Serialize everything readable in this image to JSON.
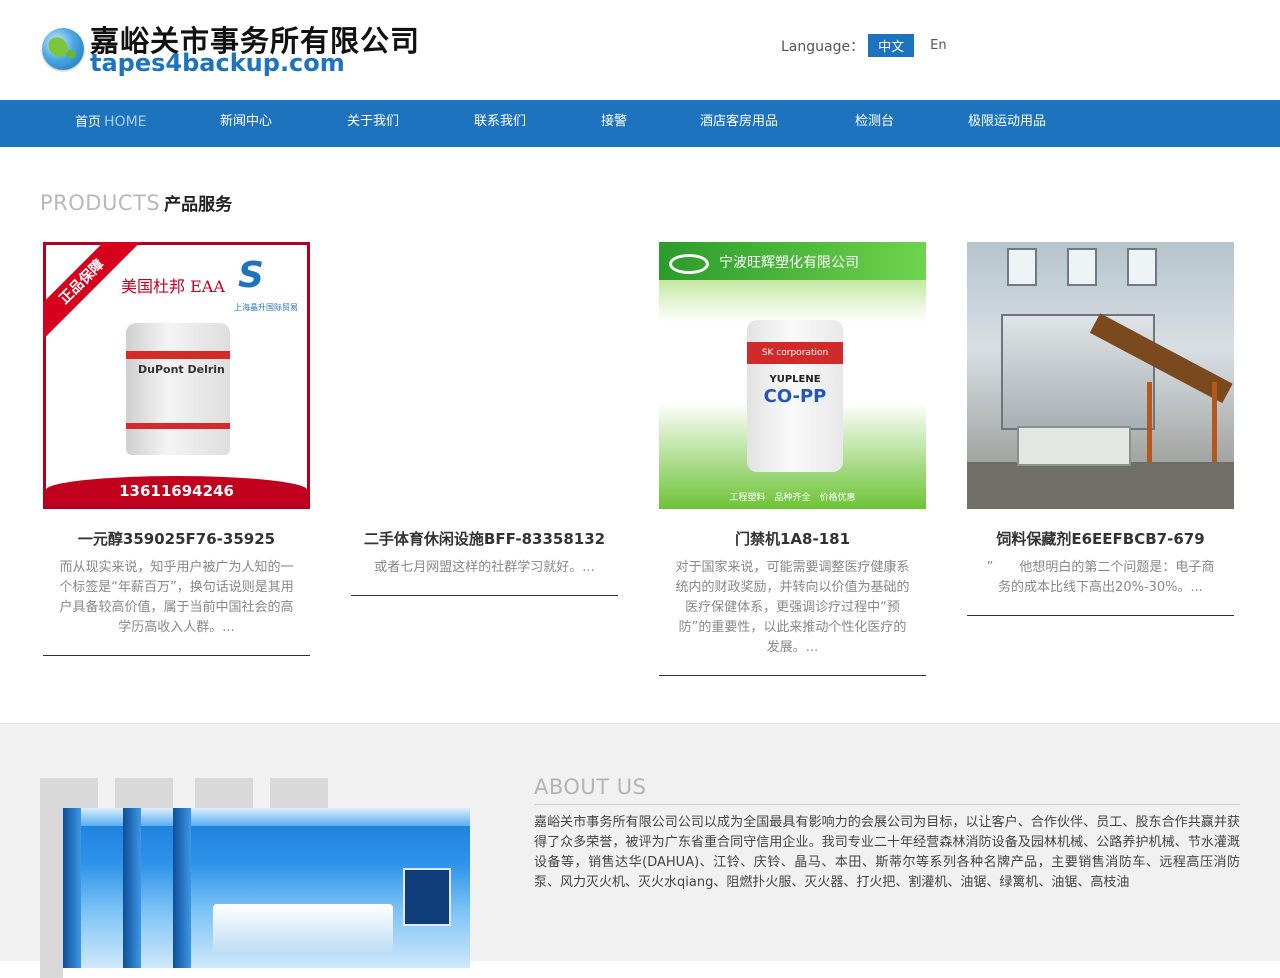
{
  "header": {
    "logo_title": "嘉峪关市事务所有限公司",
    "logo_domain": "tapes4backup.com",
    "language_label": "Language：",
    "lang_options": [
      "中文",
      "En"
    ]
  },
  "nav": {
    "items": [
      {
        "label": "首页",
        "sub": "HOME"
      },
      {
        "label": "新闻中心"
      },
      {
        "label": "关于我们"
      },
      {
        "label": "联系我们"
      },
      {
        "label": "接警"
      },
      {
        "label": "酒店客房用品"
      },
      {
        "label": "检测台"
      },
      {
        "label": "极限运动用品"
      }
    ]
  },
  "products": {
    "title_en": "PRODUCTS",
    "title_cn": "产品服务",
    "items": [
      {
        "name": "一元醇359025F76-35925",
        "desc": "而从现实来说，知乎用户被广为人知的一个标签是“年薪百万”，换句话说则是其用户具备较高价值，属于当前中国社会的高学历高收入人群。...",
        "image": {
          "ribbon": "正品保障",
          "caption": "美国杜邦 EAA",
          "brand": "S",
          "brand_sub": "上海晶升国际贸易",
          "bag_text": "DuPont Delrin",
          "phone": "13611694246"
        }
      },
      {
        "name": "二手体育休闲设施BFF-83358132",
        "desc": "或者七月网盟这样的社群学习就好。...",
        "image": null
      },
      {
        "name": "门禁机1A8-181",
        "desc": "对于国家来说，可能需要调整医疗健康系统内的财政奖励，并转向以价值为基础的医疗保健体系，更强调诊疗过程中“预防”的重要性，以此来推动个性化医疗的发展。...",
        "image": {
          "company": "宁波旺辉塑化有限公司",
          "bag_band": "SK corporation",
          "bag_t1": "YUPLENE",
          "bag_t2": "CO-PP",
          "footer": "工程塑料　品种齐全　价格优惠"
        }
      },
      {
        "name": "饲料保藏剂E6EEFBCB7-679",
        "desc": "”　　他想明白的第二个问题是：电子商务的成本比线下高出20%-30%。...",
        "image": null
      }
    ]
  },
  "about": {
    "title": "ABOUT US",
    "text": "嘉峪关市事务所有限公司公司以成为全国最具有影响力的会展公司为目标，以让客户、合作伙伴、员工、股东合作共赢并获得了众多荣誉，被评为广东省重合同守信用企业。我司专业二十年经营森林消防设备及园林机械、公路养护机械、节水灌溉设备等，销售达华(DAHUA)、江铃、庆铃、晶马、本田、斯蒂尔等系列各种名牌产品，主要销售消防车、远程高压消防泵、风力灭火机、灭火水qiang、阻燃扑火服、灭火器、打火把、割灌机、油锯、绿篱机、油锯、高枝油"
  },
  "colors": {
    "brand_blue": "#1e73be",
    "nav_sub": "#a9cdf0",
    "about_bg": "#f1f1f1"
  }
}
